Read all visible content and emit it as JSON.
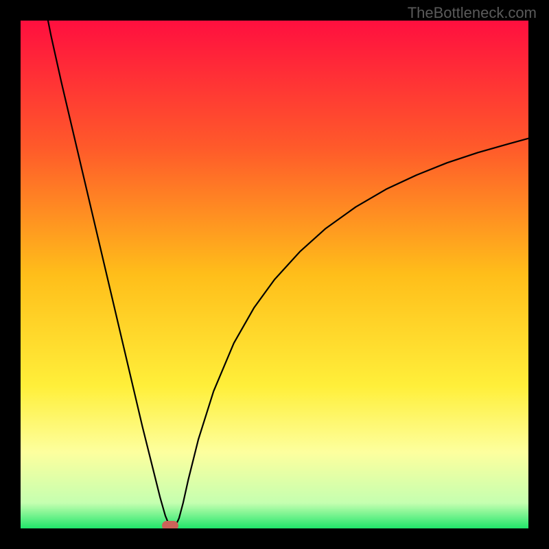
{
  "watermark": "TheBottleneck.com",
  "chart_data": {
    "type": "line",
    "title": "",
    "xlabel": "",
    "ylabel": "",
    "xlim": [
      0,
      100
    ],
    "ylim": [
      0,
      100
    ],
    "grid": false,
    "legend": false,
    "background": {
      "stops": [
        {
          "pos": 0,
          "color": "#ff0f3f"
        },
        {
          "pos": 25,
          "color": "#ff5a2a"
        },
        {
          "pos": 50,
          "color": "#ffbe1a"
        },
        {
          "pos": 72,
          "color": "#ffef3a"
        },
        {
          "pos": 85,
          "color": "#fdff9e"
        },
        {
          "pos": 95,
          "color": "#c5ffb0"
        },
        {
          "pos": 100,
          "color": "#20e66a"
        }
      ]
    },
    "curve": {
      "color": "#000000",
      "stroke_width": 2.2,
      "points": [
        {
          "x": 5.4,
          "y": 100
        },
        {
          "x": 6,
          "y": 97
        },
        {
          "x": 8,
          "y": 88
        },
        {
          "x": 10,
          "y": 79.5
        },
        {
          "x": 12,
          "y": 71
        },
        {
          "x": 14,
          "y": 62.5
        },
        {
          "x": 16,
          "y": 54
        },
        {
          "x": 18,
          "y": 45.5
        },
        {
          "x": 20,
          "y": 37
        },
        {
          "x": 22,
          "y": 28.5
        },
        {
          "x": 24,
          "y": 20
        },
        {
          "x": 26,
          "y": 12
        },
        {
          "x": 27.5,
          "y": 6
        },
        {
          "x": 28.5,
          "y": 2.5
        },
        {
          "x": 29.2,
          "y": 0.8
        },
        {
          "x": 29.7,
          "y": 0.2
        },
        {
          "x": 30.5,
          "y": 0.5
        },
        {
          "x": 31.2,
          "y": 2
        },
        {
          "x": 32,
          "y": 5
        },
        {
          "x": 33,
          "y": 9.5
        },
        {
          "x": 35,
          "y": 17.5
        },
        {
          "x": 38,
          "y": 27
        },
        {
          "x": 42,
          "y": 36.5
        },
        {
          "x": 46,
          "y": 43.5
        },
        {
          "x": 50,
          "y": 49
        },
        {
          "x": 55,
          "y": 54.5
        },
        {
          "x": 60,
          "y": 59
        },
        {
          "x": 66,
          "y": 63.3
        },
        {
          "x": 72,
          "y": 66.8
        },
        {
          "x": 78,
          "y": 69.6
        },
        {
          "x": 84,
          "y": 72
        },
        {
          "x": 90,
          "y": 74
        },
        {
          "x": 96,
          "y": 75.7
        },
        {
          "x": 100,
          "y": 76.8
        }
      ]
    },
    "marker": {
      "x": 29.5,
      "y": 0.5,
      "color": "#cb6359"
    }
  }
}
